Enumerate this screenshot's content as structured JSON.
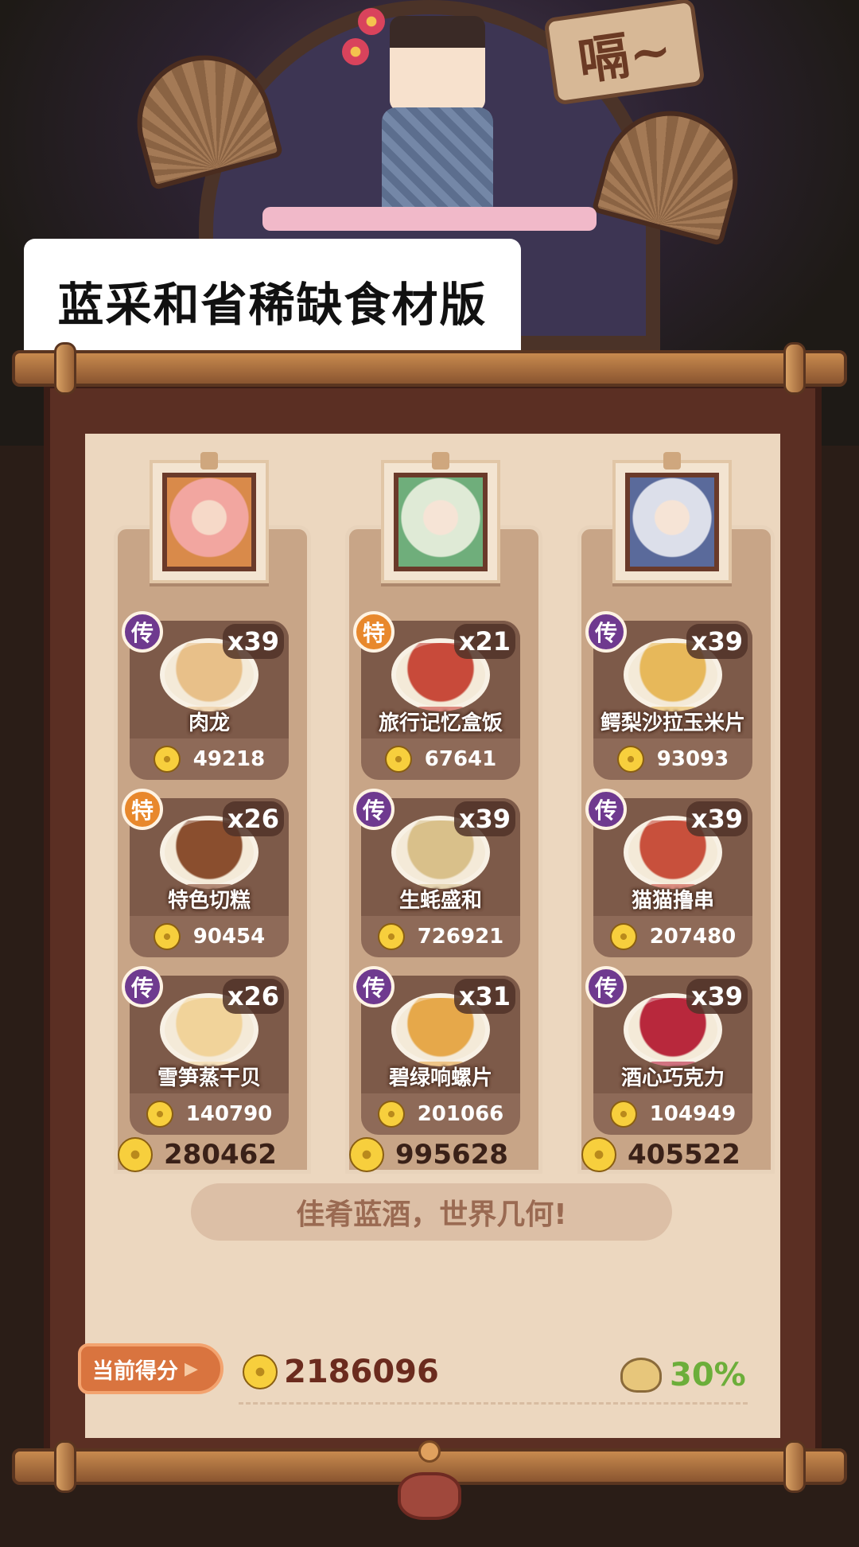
{
  "banner": {
    "title": "蓝采和省稀缺食材版",
    "sign_text": "嗝~"
  },
  "colors": {
    "legend_badge": "#6f3a8f",
    "special_badge": "#e8882c",
    "score_label_bg": "#d9743f",
    "bonus_green": "#6cae3a"
  },
  "columns": [
    {
      "portrait": "chibi-character-1",
      "total": "280462",
      "dishes": [
        {
          "name": "肉龙",
          "badge": "传",
          "badge_type": "legend",
          "qty": "x39",
          "price": "49218",
          "food_color": "#e8c089"
        },
        {
          "name": "特色切糕",
          "badge": "特",
          "badge_type": "special",
          "qty": "x26",
          "price": "90454",
          "food_color": "#8a4e2e"
        },
        {
          "name": "雪笋蒸干贝",
          "badge": "传",
          "badge_type": "legend",
          "qty": "x26",
          "price": "140790",
          "food_color": "#f1d39a"
        }
      ]
    },
    {
      "portrait": "chibi-character-2",
      "total": "995628",
      "dishes": [
        {
          "name": "旅行记忆盒饭",
          "badge": "特",
          "badge_type": "special",
          "qty": "x21",
          "price": "67641",
          "food_color": "#c84a3a"
        },
        {
          "name": "生蚝盛和",
          "badge": "传",
          "badge_type": "legend",
          "qty": "x39",
          "price": "726921",
          "food_color": "#d9c08a"
        },
        {
          "name": "碧绿响螺片",
          "badge": "传",
          "badge_type": "legend",
          "qty": "x31",
          "price": "201066",
          "food_color": "#e6a84a"
        }
      ]
    },
    {
      "portrait": "chibi-character-3",
      "total": "405522",
      "dishes": [
        {
          "name": "鳄梨沙拉玉米片",
          "badge": "传",
          "badge_type": "legend",
          "qty": "x39",
          "price": "93093",
          "food_color": "#e7b85a"
        },
        {
          "name": "猫猫撸串",
          "badge": "传",
          "badge_type": "legend",
          "qty": "x39",
          "price": "207480",
          "food_color": "#c8503c"
        },
        {
          "name": "酒心巧克力",
          "badge": "传",
          "badge_type": "legend",
          "qty": "x39",
          "price": "104949",
          "food_color": "#b8283c"
        }
      ]
    }
  ],
  "slogan": "佳肴蓝酒，世界几何!",
  "score": {
    "label": "当前得分",
    "value": "2186096",
    "percent": "30%"
  }
}
